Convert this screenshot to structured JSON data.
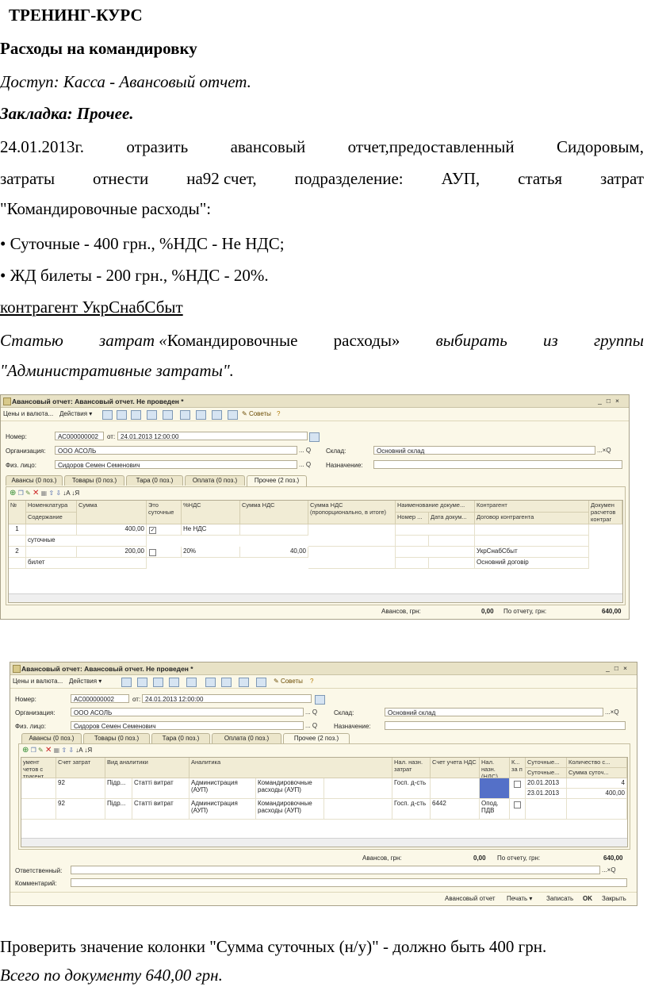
{
  "doc": {
    "title": "ТРЕНИНГ-КУРС",
    "heading": "Расходы на командировку",
    "access": "Доступ: Касса - Авансовый отчет.",
    "tab_label": "Закладка: Прочее.",
    "task_line1": [
      "24.01.2013г.",
      "отразить",
      "авансовый",
      "отчет,предоставленный",
      "Сидоровым,"
    ],
    "task_line2": [
      "затраты",
      "отнести",
      "на92",
      "счет,",
      "подразделение:",
      "АУП,",
      "статья",
      "затрат"
    ],
    "task_line3": "\"Командировочные расходы\":",
    "bullet1": "• Суточные - 400 грн.,  %НДС - Не НДС;",
    "bullet2": "• ЖД билеты - 200 грн., %НДС - 20%.",
    "counterparty": "контрагент УкрСнабСбыт",
    "note_line1": {
      "w1": "Статью",
      "w2": "затрат «",
      "w3": "Командировочные",
      "w4": "расходы»",
      "w5": "выбирать",
      "w6": "из",
      "w7": "группы"
    },
    "note_line2": "\"Административные затраты\".",
    "check_text": "Проверить значение колонки \"Сумма суточных (н/у)\" - должно быть 400 грн.",
    "total_text": "Всего по документу 640,00 грн."
  },
  "win": {
    "title": "Авансовый отчет: Авансовый отчет. Не проведен *",
    "buttons": [
      "_",
      "□",
      "×"
    ],
    "toolbar": {
      "prices": "Цены и валюта...",
      "actions": "Действия ▾",
      "tips": "Советы"
    },
    "fields": {
      "number_label": "Номер:",
      "number": "АС000000002",
      "from_label": "от:",
      "date": "24.01.2013 12:00:00",
      "org_label": "Организация:",
      "org": "ООО АСОЛЬ",
      "person_label": "Физ. лицо:",
      "person": "Сидоров Семен Семенович",
      "warehouse_label": "Склад:",
      "warehouse": "Основний склад",
      "purpose_label": "Назначение:",
      "dots": "...",
      "search": "Q",
      "clear": "×"
    },
    "tabs": [
      "Авансы (0 поз.)",
      "Товары (0 поз.)",
      "Тара (0 поз.)",
      "Оплата (0 поз.)",
      "Прочее (2 поз.)"
    ],
    "grid1": {
      "headers": {
        "num": "№",
        "nom": "Номенклатура",
        "content": "Содержание",
        "sum": "Сумма",
        "daily": "Это суточные",
        "vat_pct": "%НДС",
        "vat_sum": "Сумма НДС",
        "vat_incl": "Сумма НДС (пропорционально, в итоге)",
        "doc_name": "Наименование докуме...",
        "doc_no": "Номер ...",
        "doc_date": "Дата докум...",
        "contractor": "Контрагент",
        "contract": "Договор контрагента",
        "doc_calc": "Докумен расчетов контраг"
      },
      "rows": [
        {
          "n": "1",
          "sum": "400,00",
          "checked": true,
          "check_mark": "✓",
          "vat": "Не НДС",
          "vat_sum": "",
          "content": "суточные",
          "contractor": "",
          "contract": ""
        },
        {
          "n": "2",
          "sum": "200,00",
          "checked": false,
          "check_mark": "",
          "vat": "20%",
          "vat_sum": "40,00",
          "content": "билет",
          "contractor": "УкрСнабСбыт",
          "contract": "Основний договір"
        }
      ]
    },
    "grid2": {
      "headers": {
        "doc": "умент четов с трагент",
        "account": "Счет затрат",
        "analytics_kind": "Вид аналитики",
        "analytics": "Аналитика",
        "tax_purpose": "Нал. назн. затрат",
        "vat_account": "Счет учета НДС",
        "tax_purpose_vat": "Нал. назн. (НДС)",
        "kz": "К... за п",
        "daily1": "Суточные...",
        "daily2": "Суточные...",
        "qty": "Количество с...",
        "daily_sum": "Сумма суточ..."
      },
      "rows": [
        {
          "account": "92",
          "kind1": "Підр...",
          "kind2": "Статті витрат",
          "an1": "Администрация (АУП)",
          "an2": "Командировочные расходы (АУП)",
          "tax": "Госп. д-сть",
          "vat_acc": "",
          "tax_vat": "",
          "d1": "20.01.2013",
          "d2": "23.01.2013",
          "qty": "4",
          "dsum": "400,00"
        },
        {
          "account": "92",
          "kind1": "Підр...",
          "kind2": "Статті витрат",
          "an1": "Администрация (АУП)",
          "an2": "Командировочные расходы (АУП)",
          "tax": "Госп. д-сть",
          "vat_acc": "6442",
          "tax_vat": "Опод. ПДВ",
          "d1": "",
          "d2": "",
          "qty": "",
          "dsum": ""
        }
      ]
    },
    "footer": {
      "advances_label": "Авансов, грн:",
      "advances": "0,00",
      "report_label": "По отчету, грн:",
      "report": "640,00",
      "responsible_label": "Ответственный:",
      "comment_label": "Комментарий:",
      "bottom_buttons": [
        "Авансовый отчет",
        "Печать ▾",
        "Записать",
        "OK",
        "Закрыть"
      ]
    },
    "icons": {
      "accent": "#3d5aa8"
    }
  }
}
